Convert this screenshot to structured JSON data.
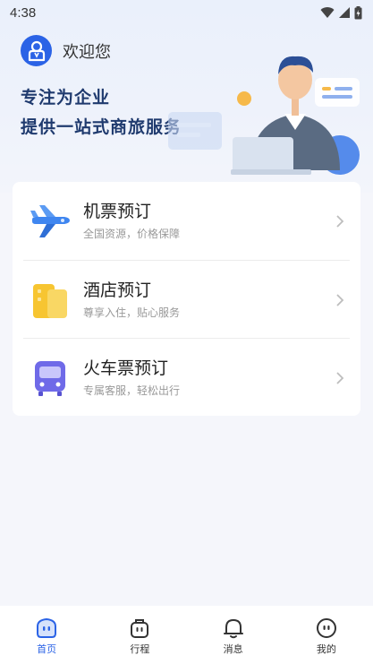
{
  "status_bar": {
    "time": "4:38"
  },
  "header": {
    "greeting": "欢迎您",
    "slogan_line1": "专注为企业",
    "slogan_line2": "提供一站式商旅服务"
  },
  "services": [
    {
      "title": "机票预订",
      "subtitle": "全国资源，价格保障",
      "icon": "airplane-icon"
    },
    {
      "title": "酒店预订",
      "subtitle": "尊享入住，贴心服务",
      "icon": "hotel-icon"
    },
    {
      "title": "火车票预订",
      "subtitle": "专属客服，轻松出行",
      "icon": "train-icon"
    }
  ],
  "tabbar": {
    "active_index": 0,
    "items": [
      {
        "label": "首页",
        "icon": "home-icon"
      },
      {
        "label": "行程",
        "icon": "suitcase-icon"
      },
      {
        "label": "消息",
        "icon": "bell-icon"
      },
      {
        "label": "我的",
        "icon": "profile-icon"
      }
    ]
  },
  "colors": {
    "accent": "#2b63e6",
    "background": "#f5f6fb",
    "hotel": "#f7c531",
    "train": "#6f6ae8",
    "plane": "#3f86f0"
  }
}
